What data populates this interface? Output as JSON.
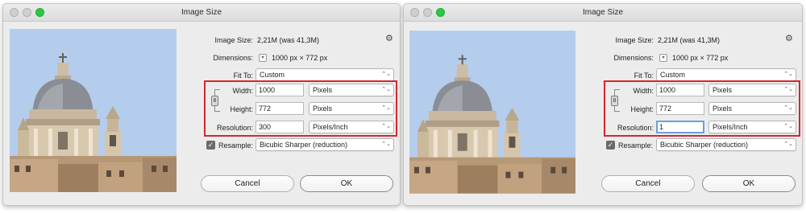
{
  "dialogs": [
    {
      "title": "Image Size",
      "image_size_label": "Image Size:",
      "image_size_value": "2,21M (was 41,3M)",
      "dimensions_label": "Dimensions:",
      "dimensions_value": "1000 px  ×  772 px",
      "fit_to_label": "Fit To:",
      "fit_to_value": "Custom",
      "width_label": "Width:",
      "width_value": "1000",
      "width_unit": "Pixels",
      "height_label": "Height:",
      "height_value": "772",
      "height_unit": "Pixels",
      "resolution_label": "Resolution:",
      "resolution_value": "300",
      "resolution_unit": "Pixels/Inch",
      "resample_label": "Resample:",
      "resample_value": "Bicubic Sharper (reduction)",
      "cancel_label": "Cancel",
      "ok_label": "OK"
    },
    {
      "title": "Image Size",
      "image_size_label": "Image Size:",
      "image_size_value": "2,21M (was 41,3M)",
      "dimensions_label": "Dimensions:",
      "dimensions_value": "1000 px  ×  772 px",
      "fit_to_label": "Fit To:",
      "fit_to_value": "Custom",
      "width_label": "Width:",
      "width_value": "1000",
      "width_unit": "Pixels",
      "height_label": "Height:",
      "height_value": "772",
      "height_unit": "Pixels",
      "resolution_label": "Resolution:",
      "resolution_value": "1",
      "resolution_unit": "Pixels/Inch",
      "resample_label": "Resample:",
      "resample_value": "Bicubic Sharper (reduction)",
      "cancel_label": "Cancel",
      "ok_label": "OK"
    }
  ],
  "icons": {
    "gear": "⚙",
    "chevron": "⌃⌄",
    "link": "8",
    "checkmark": "✓",
    "dimensions_menu": "▾"
  },
  "colors": {
    "highlight_box": "#d6262e",
    "focus_ring": "#6c9fe0",
    "close_light": "#d0d0d0",
    "zoom_light": "#2ac845"
  }
}
